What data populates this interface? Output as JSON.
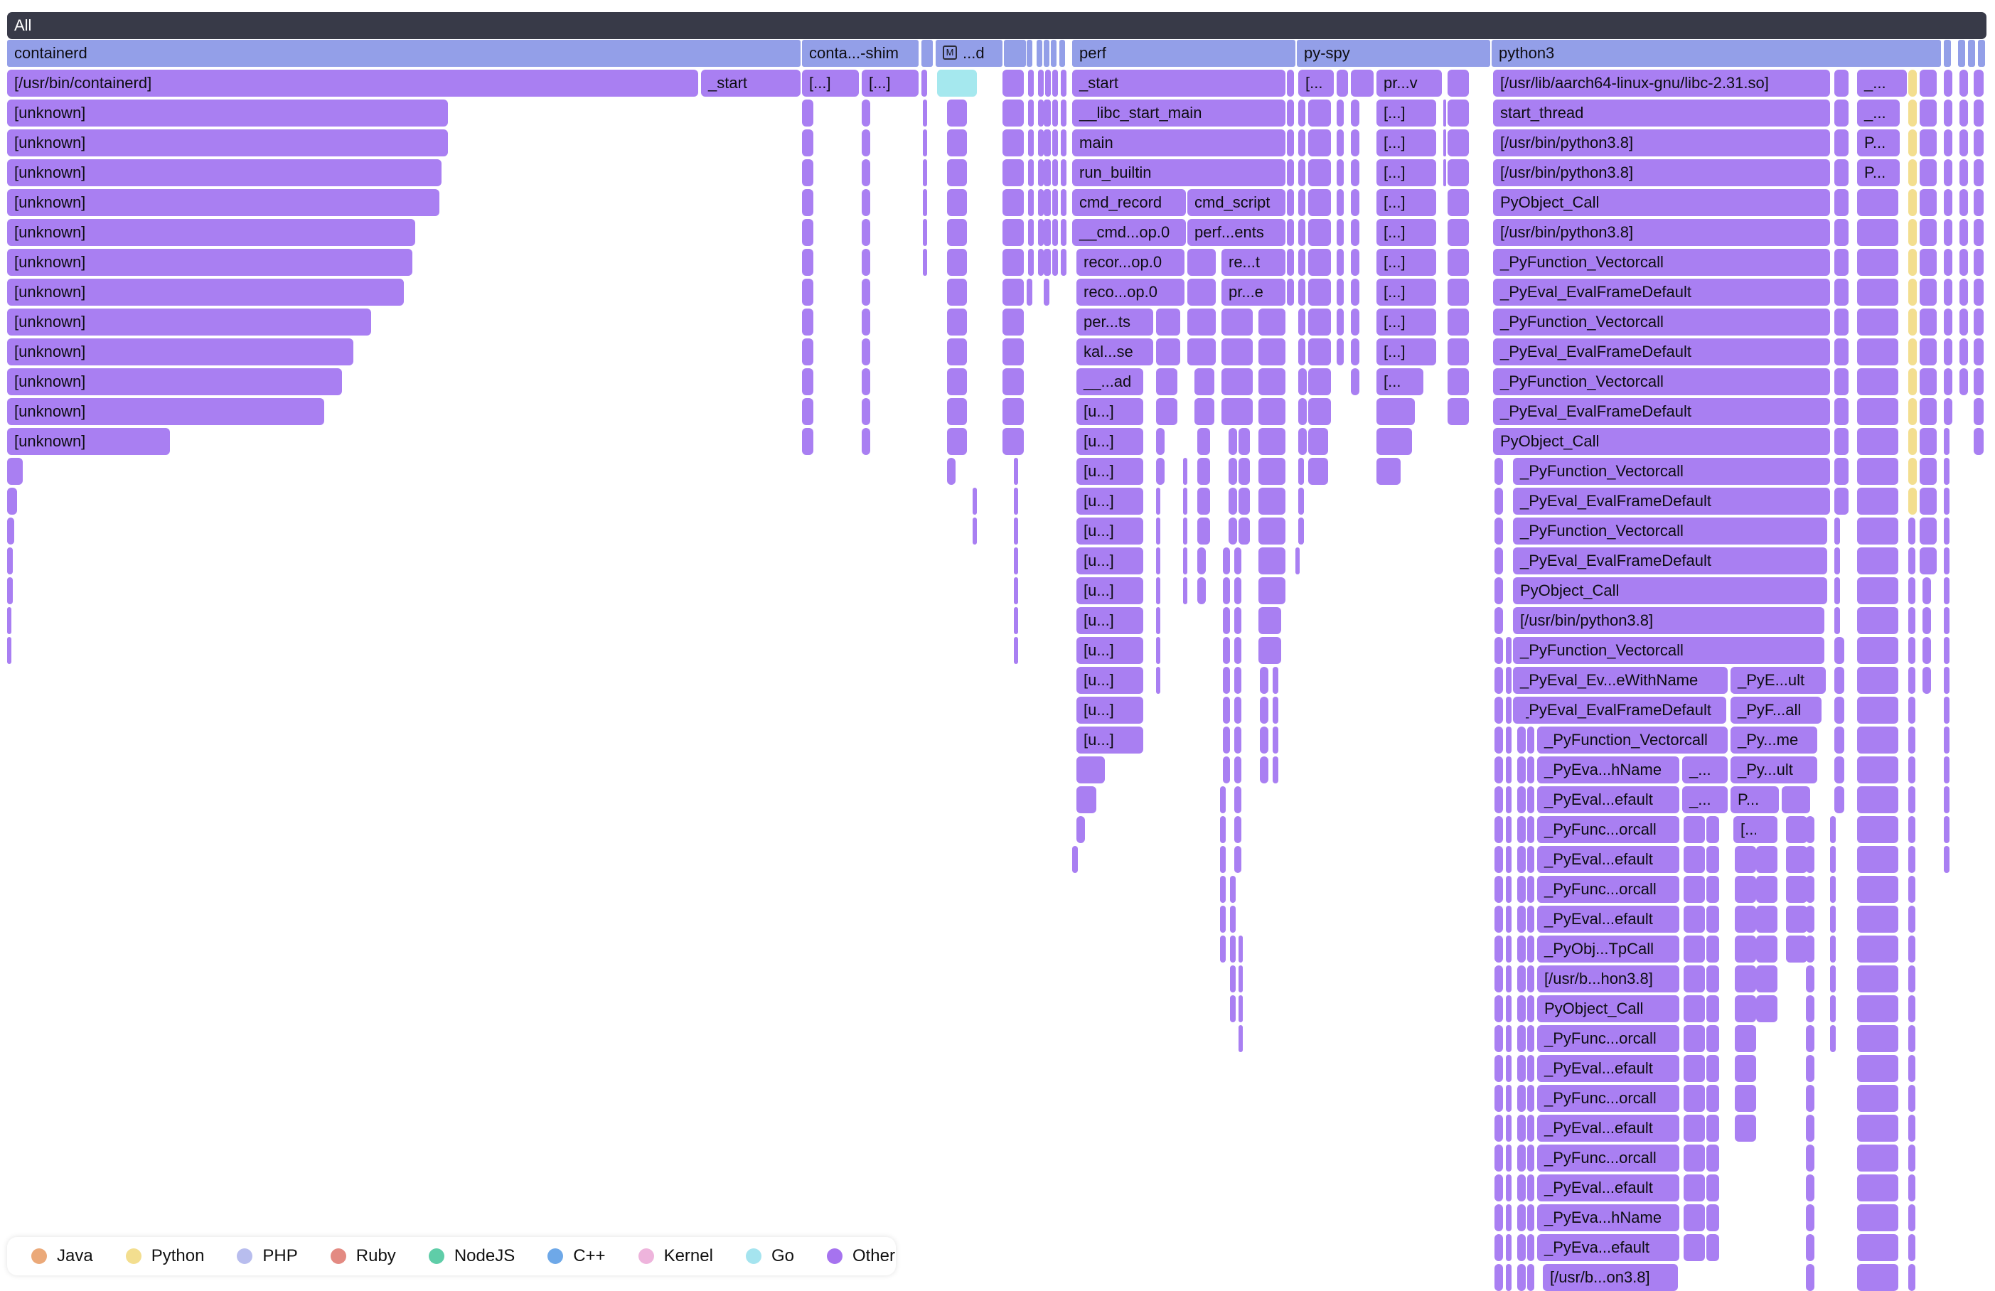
{
  "flamegraph": {
    "colors": {
      "root": "#383a48",
      "process": "#939fe8",
      "other": "#a97ff2",
      "go": "#a5e8ee",
      "python": "#f3de8f"
    },
    "root": {
      "label": "All"
    },
    "processes": [
      {
        "label": "containerd"
      },
      {
        "label": "conta...-shim"
      },
      {
        "label": "...d",
        "badge": "M"
      },
      {
        "label": "perf"
      },
      {
        "label": "py-spy"
      },
      {
        "label": "python3"
      }
    ],
    "containerd": {
      "binary": "[/usr/bin/containerd]",
      "start": "_start",
      "stack_label": "[unknown]",
      "unknown_depth_fractions": [
        1.0,
        1.0,
        0.985,
        0.98,
        0.925,
        0.92,
        0.9,
        0.825,
        0.785,
        0.76,
        0.72,
        0.37
      ]
    },
    "shim": {
      "frame_a": "[...]",
      "frame_b": "[...]"
    },
    "perf": {
      "frames": {
        "start": "_start",
        "libc_start_main": "__libc_start_main",
        "main": "main",
        "run_builtin": "run_builtin",
        "cmd_record": "cmd_record",
        "cmd_script": "cmd_script",
        "cmd_op": "__cmd...op.0",
        "perf_events": "perf...ents",
        "recor_op": "recor...op.0",
        "re_t": "re...t",
        "reco_op": "reco...op.0",
        "pr_e": "pr...e",
        "per_ts": "per...ts",
        "kal_se": "kal...se",
        "ad": "__...ad",
        "unknown_short": "[u...]"
      }
    },
    "pyspy": {
      "pr_v": "pr...v",
      "dots_open": "[...",
      "dots": "[...]"
    },
    "python3": {
      "frames": {
        "libc": "[/usr/lib/aarch64-linux-gnu/libc-2.31.so]",
        "start_thread": "start_thread",
        "python_bin": "[/usr/bin/python3.8]",
        "pyobject_call": "PyObject_Call",
        "pyfunction_vectorcall": "_PyFunction_Vectorcall",
        "pyeval_framedefault": "_PyEval_EvalFrameDefault",
        "eval_with_name": "_PyEval_Ev...eWithName",
        "pye_ult": "_PyE...ult",
        "pyf_all": "_PyF...all",
        "py_me": "_Py...me",
        "pyeva_hname": "_PyEva...hName",
        "underscore_dots": "_...",
        "py_ult": "_Py...ult",
        "p_dots": "P...",
        "pyeval_efault": "_PyEval...efault",
        "pyfunc_orcall": "_PyFunc...orcall",
        "dots_open": "[...",
        "pyobj_tpcall": "_PyObj...TpCall",
        "usr_b_hon": "[/usr/b...hon3.8]",
        "pyeva_efault": "_PyEva...efault",
        "usr_b_on": "[/usr/b...on3.8]",
        "small_a": "_...",
        "small_p": "P..."
      }
    }
  },
  "legend": {
    "items": [
      {
        "label": "Java",
        "color": "#eba979"
      },
      {
        "label": "Python",
        "color": "#f3de8f"
      },
      {
        "label": "PHP",
        "color": "#b8bdee"
      },
      {
        "label": "Ruby",
        "color": "#e38a82"
      },
      {
        "label": "NodeJS",
        "color": "#5fcda8"
      },
      {
        "label": "C++",
        "color": "#6ea8e8"
      },
      {
        "label": "Kernel",
        "color": "#eeb4dc"
      },
      {
        "label": "Go",
        "color": "#a5e4ef"
      },
      {
        "label": "Other",
        "color": "#a673ef"
      }
    ]
  }
}
